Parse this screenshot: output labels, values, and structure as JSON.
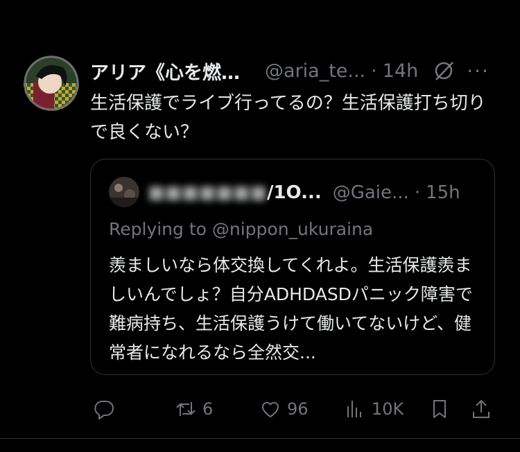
{
  "tweet": {
    "display_name": "アリア《心を燃…",
    "handle": "@aria_te...",
    "dot": "·",
    "time": "14h",
    "more": "···",
    "text": "生活保護でライブ行ってるの？生活保護打ち切りで良くない？"
  },
  "quote": {
    "display_name_tail": "/1O...",
    "handle": "@Gaie...",
    "dot": "·",
    "time": "15h",
    "replying_to": "Replying to @nippon_ukuraina",
    "text": "羨ましいなら体交換してくれよ。生活保護羨ましいんでしょ？自分ADHDASDパニック障害で難病持ち、生活保護うけて働いてないけど、健常者になれるなら全然交..."
  },
  "actions": {
    "reply_icon": "reply-icon",
    "retweet_count": "6",
    "like_count": "96",
    "view_count": "10K"
  },
  "colors": {
    "background": "#000000",
    "text_primary": "#e7e9ea",
    "text_secondary": "#71767b",
    "border": "#2f3336"
  }
}
